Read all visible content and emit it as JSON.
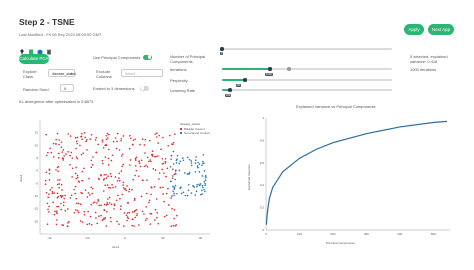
{
  "header": {
    "title": "Step 2 - TSNE",
    "last_modified": "Last Modified - Fri 08 Sep 2023 08:00:00 GMT",
    "apply_label": "Apply",
    "next_app_label": "Next App"
  },
  "controls": {
    "calculate_pca_label": "Calculate PCA",
    "use_pca_label": "Use Principal Components",
    "explore_class_label": "Explore Class",
    "explore_class_value": "disease_status",
    "exclude_columns_label": "Exclude Columns",
    "exclude_columns_placeholder": "Select...",
    "random_seed_label": "Random Seed",
    "random_seed_value": "0",
    "embed_3d_label": "Embed in 3 dimensions",
    "kl_divergence": "KL divergence after optimisation is 0.6873"
  },
  "sliders": {
    "num_pc_label": "Number of Principal Components",
    "num_pc_value": "2",
    "iterations_label": "Iterations",
    "iterations_value": "1000",
    "perplexity_label": "Perplexity",
    "perplexity_value": "30",
    "learning_rate_label": "Learning Rate",
    "learning_rate_value": "200"
  },
  "info": {
    "selected_text": "5 selected, explained variance: 0.418",
    "iterations_text": "1000 iterations"
  },
  "colors": {
    "accent": "#2bb673",
    "bladder_cancel": "#d62728",
    "non_cancel_control": "#1f77b4"
  },
  "chart_data": [
    {
      "type": "scatter",
      "title": "",
      "xlabel": "tsne1",
      "ylabel": "tsne2",
      "xlim": [
        -45,
        45
      ],
      "ylim": [
        -25,
        20
      ],
      "x_ticks": [
        "-40",
        "-20",
        "0",
        "20",
        "40"
      ],
      "y_ticks": [
        "15",
        "10",
        "5",
        "0",
        "-5",
        "-10",
        "-15",
        "-20"
      ],
      "legend_title": "disease_status",
      "legend_placement": "top-right",
      "series": [
        {
          "name": "Bladder Cancel",
          "color": "#d62728",
          "x_range": [
            -42,
            28
          ],
          "y_range": [
            -22,
            15
          ]
        },
        {
          "name": "Non-cancel Control",
          "color": "#1f77b4",
          "x_range": [
            24,
            43
          ],
          "y_range": [
            -10,
            7
          ]
        }
      ]
    },
    {
      "type": "line",
      "title": "Explained Variance vs Principal Components",
      "xlabel": "Principal components",
      "ylabel": "Explained Variance",
      "xlim": [
        0,
        550
      ],
      "ylim": [
        0,
        1
      ],
      "x_ticks": [
        "0",
        "100",
        "200",
        "300",
        "400",
        "500"
      ],
      "y_ticks": [
        "1",
        "0.8",
        "0.6",
        "0.4",
        "0.2",
        "0"
      ],
      "x": [
        1,
        5,
        10,
        20,
        50,
        100,
        150,
        200,
        300,
        400,
        500,
        540
      ],
      "y": [
        0.05,
        0.18,
        0.28,
        0.38,
        0.52,
        0.64,
        0.72,
        0.78,
        0.86,
        0.92,
        0.96,
        0.97
      ]
    }
  ]
}
